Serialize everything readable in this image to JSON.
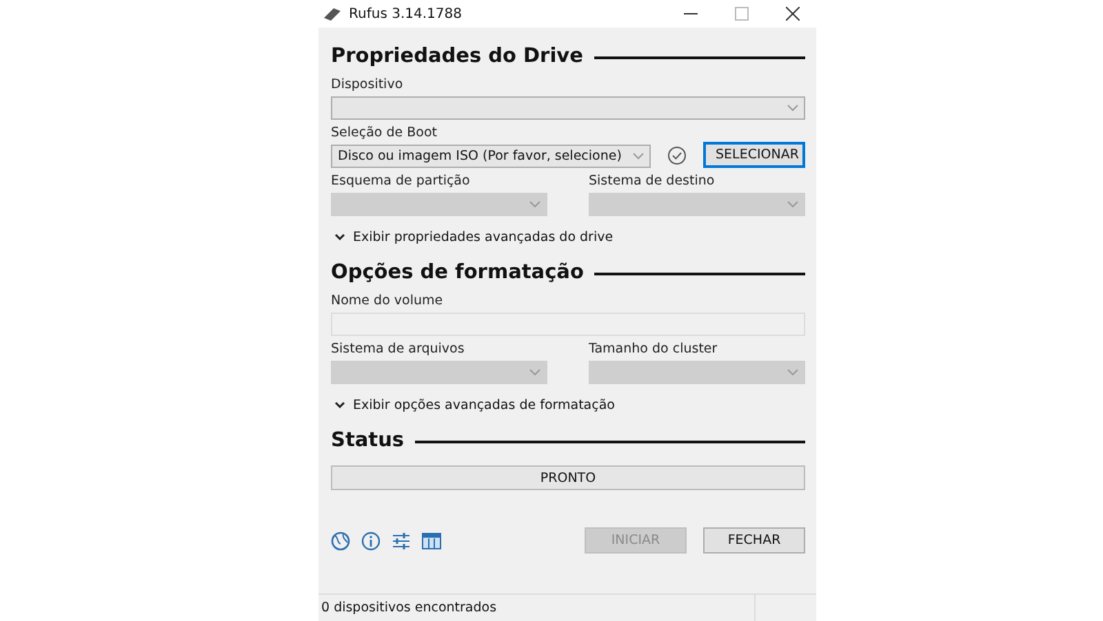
{
  "window": {
    "title": "Rufus 3.14.1788"
  },
  "sections": [
    {
      "heading": "Propriedades do Drive",
      "rows": [
        [
          {
            "kind": "select",
            "label": "Dispositivo",
            "disabled": false
          }
        ],
        [
          {
            "kind": "select",
            "label": "Seleção de Boot",
            "value": "Disco ou imagem ISO (Por favor, selecione)",
            "disabled": false
          },
          {
            "kind": "check"
          },
          {
            "kind": "button",
            "text": "SELECIONAR",
            "disabled": false,
            "selected": true
          }
        ],
        [
          {
            "kind": "select",
            "label": "Esquema de partição",
            "disabled": true
          },
          {
            "kind": "select",
            "label": "Sistema de destino",
            "disabled": true
          }
        ]
      ],
      "expander": "Exibir propriedades avançadas do drive"
    },
    {
      "heading": "Opções de formatação",
      "rows": [
        [
          {
            "kind": "text",
            "label": "Nome do volume",
            "disabled": true
          }
        ],
        [
          {
            "kind": "select",
            "label": "Sistema de arquivos",
            "disabled": true
          },
          {
            "kind": "select",
            "label": "Tamanho do cluster",
            "disabled": true
          }
        ]
      ],
      "expander": "Exibir opções avançadas de formatação"
    },
    {
      "heading": "Status"
    }
  ],
  "progress": {
    "text": "PRONTO"
  },
  "buttons": [
    {
      "text": "INICIAR",
      "disabled": true
    },
    {
      "text": "FECHAR",
      "disabled": false
    }
  ],
  "status_bar": {
    "text": "0 dispositivos encontrados"
  }
}
